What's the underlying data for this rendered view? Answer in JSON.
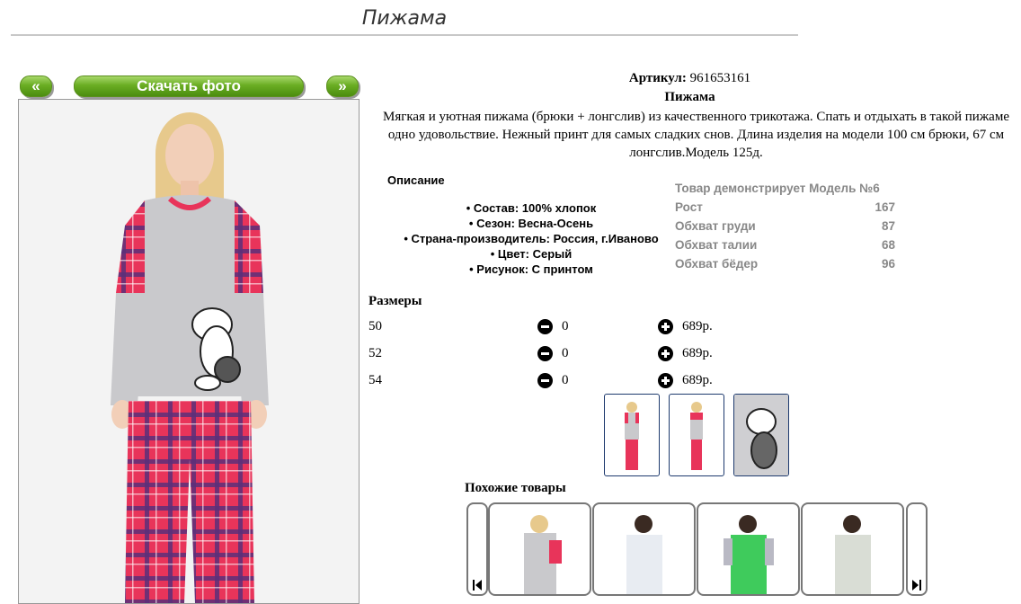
{
  "header": {
    "title": "Пижама"
  },
  "gallery": {
    "prev_label": "«",
    "download_label": "Скачать фото",
    "next_label": "»"
  },
  "product": {
    "article_label": "Артикул:",
    "article_value": "961653161",
    "name": "Пижама",
    "description": "Мягкая и уютная пижама (брюки + лонгслив) из качественного трикотажа. Спать и отдыхать в такой пижаме одно удовольствие. Нежный принт для самых сладких снов. Длина изделия на модели 100 см брюки, 67 см лонгслив.Модель 125д."
  },
  "specs": {
    "heading": "Описание",
    "items": [
      "• Состав: 100% хлопок",
      "• Сезон: Весна-Осень",
      "• Страна-производитель: Россия, г.Иваново",
      "• Цвет: Серый",
      "• Рисунок: С принтом"
    ]
  },
  "model": {
    "heading": "Товар демонстрирует Модель №6",
    "rows": [
      {
        "label": "Рост",
        "value": "167"
      },
      {
        "label": "Обхват груди",
        "value": "87"
      },
      {
        "label": "Обхват талии",
        "value": "68"
      },
      {
        "label": "Обхват бёдер",
        "value": "96"
      }
    ]
  },
  "sizes": {
    "heading": "Размеры",
    "rows": [
      {
        "size": "50",
        "qty": "0",
        "price": "689р."
      },
      {
        "size": "52",
        "qty": "0",
        "price": "689р."
      },
      {
        "size": "54",
        "qty": "0",
        "price": "689р."
      }
    ]
  },
  "similar": {
    "heading": "Похожие товары"
  },
  "colors": {
    "accent_green": "#6aad23",
    "plaid_red": "#e8345a",
    "thumb_border": "#1e3a6e"
  },
  "icons": [
    "minus-circle-icon",
    "plus-circle-icon",
    "prev-arrow-icon",
    "next-arrow-icon"
  ]
}
